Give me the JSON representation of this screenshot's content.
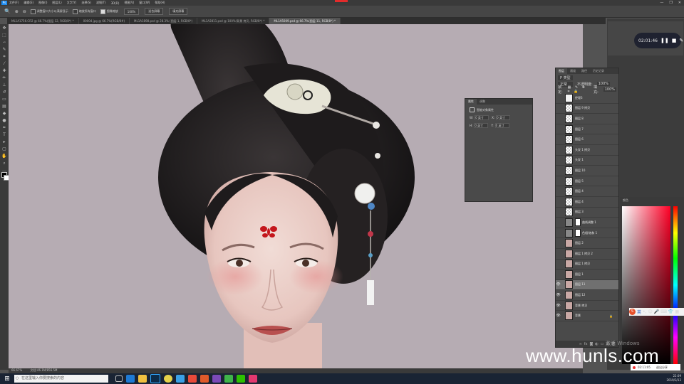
{
  "menu": {
    "app_icon": "Ps",
    "items": [
      "文件(F)",
      "编辑(E)",
      "图像(I)",
      "图层(L)",
      "文字(Y)",
      "选择(S)",
      "滤镜(T)",
      "3D(D)",
      "视图(V)",
      "窗口(W)",
      "帮助(H)"
    ]
  },
  "window_controls": {
    "minimize": "—",
    "maximize": "❐",
    "close": "✕"
  },
  "options_bar": {
    "check1": "调整窗口大小以满屏显示",
    "check2": "缩放所有窗口",
    "check3": "细微缩放",
    "zoom_value": "100%",
    "fit_screen": "适合屏幕",
    "fill_screen": "填充屏幕"
  },
  "tabs": [
    "ML1A1756.CR2 @ 66.7%(图层 12, RGB/8*) *",
    "00004.jpg @ 66.7%(RGB/8#)",
    "ML1A1898.psd @ 28.3% (图层 1, RGB/8*)",
    "ML1A2811.psd @ 100%(背景 拷贝, RGB/8*) *",
    "ML1A5009.psd @ 66.7%(图层 11, RGB/8*) *"
  ],
  "active_tab": 4,
  "recorder": {
    "time": "02:01:46"
  },
  "properties": {
    "tabs": [
      "属性",
      "调整"
    ],
    "section": "智能对象属性",
    "w_label": "W:",
    "w_value": "0 英寸",
    "x_label": "X:",
    "x_value": "0 英寸",
    "h_label": "H:",
    "h_value": "0 英寸",
    "y_label": "Y:",
    "y_value": "0 英寸"
  },
  "layers_panel": {
    "tabs": [
      "图层",
      "通道",
      "路径",
      "历史记录"
    ],
    "filter_kind": "P 类型",
    "blend_mode": "正常",
    "opacity_label": "不透明度:",
    "opacity": "100%",
    "lock_label": "锁定:",
    "fill_label": "填充:",
    "fill": "100%",
    "layers": [
      {
        "name": "经理3",
        "visible": false,
        "thumb": "white"
      },
      {
        "name": "图层 9 拷贝",
        "visible": false,
        "thumb": "checker"
      },
      {
        "name": "图层 8",
        "visible": false,
        "thumb": "checker"
      },
      {
        "name": "图层 7",
        "visible": false,
        "thumb": "checker"
      },
      {
        "name": "图层 6",
        "visible": false,
        "thumb": "checker"
      },
      {
        "name": "头发 1 拷贝",
        "visible": false,
        "thumb": "checker"
      },
      {
        "name": "头发 1",
        "visible": false,
        "thumb": "checker"
      },
      {
        "name": "图层 10",
        "visible": false,
        "thumb": "checker"
      },
      {
        "name": "图层 5",
        "visible": false,
        "thumb": "checker"
      },
      {
        "name": "图层 4",
        "visible": false,
        "thumb": "checker"
      },
      {
        "name": "图层 4",
        "visible": false,
        "thumb": "checker"
      },
      {
        "name": "图层 3",
        "visible": false,
        "thumb": "checker"
      },
      {
        "name": "曲线调整 1",
        "visible": false,
        "thumb": "gray",
        "mask": true
      },
      {
        "name": "色相/饱和 1",
        "visible": false,
        "thumb": "gray",
        "mask": true
      },
      {
        "name": "图层 2",
        "visible": false,
        "thumb": "photo"
      },
      {
        "name": "图层 1 拷贝 2",
        "visible": false,
        "thumb": "photo"
      },
      {
        "name": "图层 1 拷贝",
        "visible": false,
        "thumb": "photo"
      },
      {
        "name": "图层 1",
        "visible": false,
        "thumb": "photo"
      },
      {
        "name": "图层 11",
        "visible": true,
        "thumb": "photo",
        "selected": true
      },
      {
        "name": "图层 12",
        "visible": true,
        "thumb": "photo"
      },
      {
        "name": "背景 拷贝",
        "visible": true,
        "thumb": "photo"
      },
      {
        "name": "背景",
        "visible": true,
        "thumb": "photo",
        "locked": true
      }
    ],
    "bottom_icons": [
      "link-icon",
      "fx-icon",
      "mask-icon",
      "adjustment-icon",
      "group-icon",
      "new-layer-icon",
      "trash-icon"
    ]
  },
  "color_panel": {
    "tab": "颜色",
    "hue_color": "#ff0026"
  },
  "status": {
    "zoom": "66.67%",
    "doc": "文档:46.1M/856.5M"
  },
  "watermark": "www.hunls.com",
  "activate_windows": "激活 Windows",
  "ime": {
    "label": "英"
  },
  "rec_mini": {
    "time": "02:11:05",
    "stop_label": "退出分享"
  },
  "taskbar": {
    "search_placeholder": "在这里输入你要搜索的内容",
    "clock_time": "22:09",
    "clock_date": "2019/3/13"
  }
}
